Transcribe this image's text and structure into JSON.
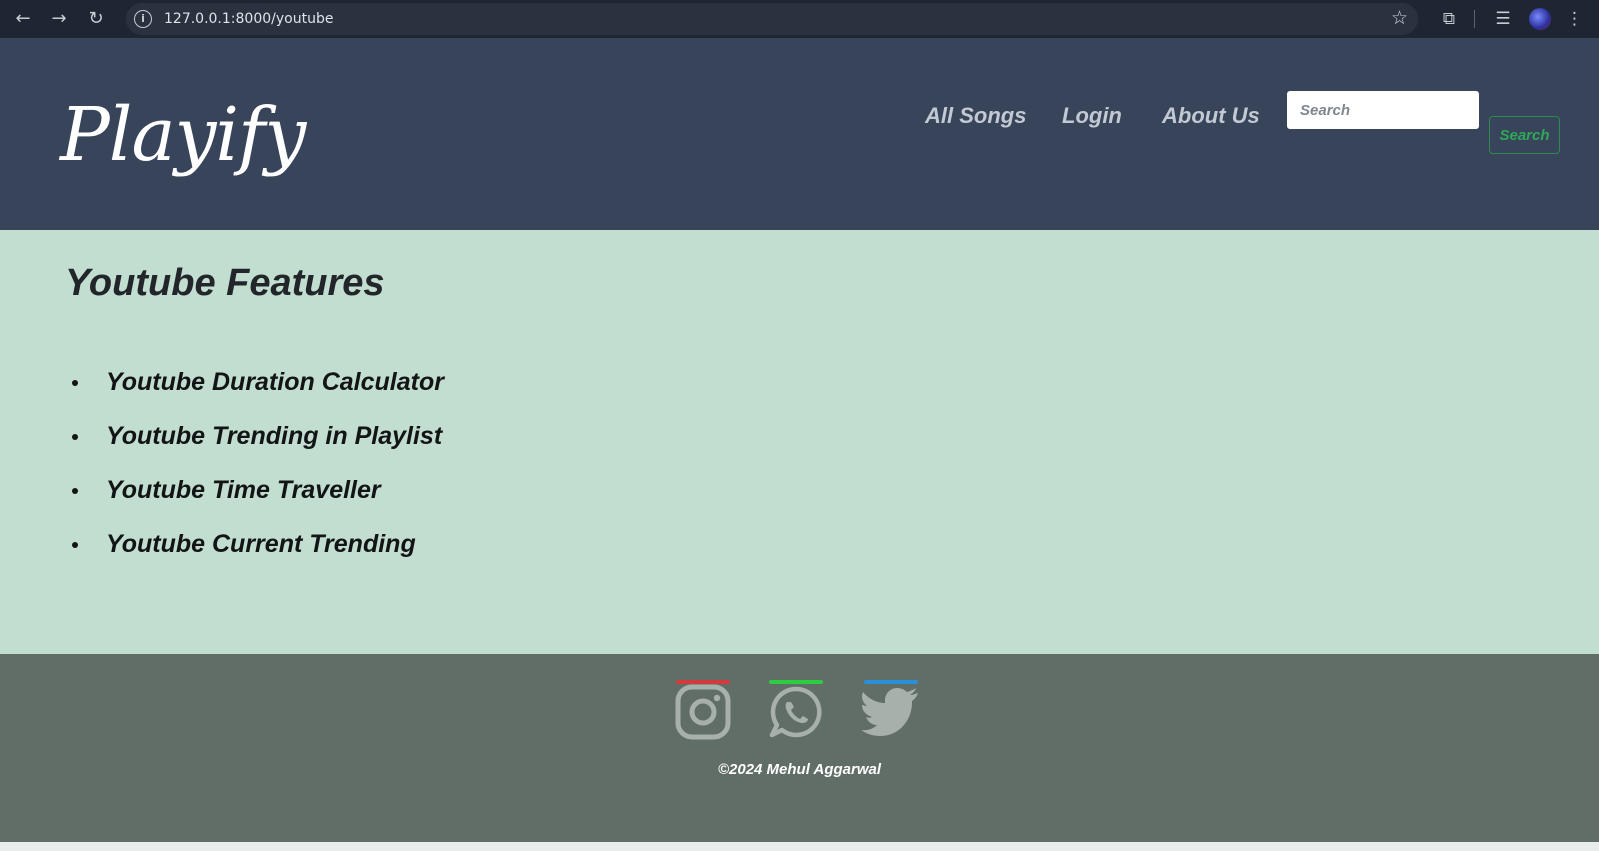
{
  "browser": {
    "url": "127.0.0.1:8000/youtube",
    "icons": [
      "back-icon",
      "forward-icon",
      "reload-icon",
      "info-icon",
      "bookmark-star-icon",
      "extensions-icon",
      "reading-list-icon",
      "profile-avatar",
      "menu-icon"
    ]
  },
  "header": {
    "logo": "Playify",
    "nav": [
      {
        "label": "All Songs"
      },
      {
        "label": "Login"
      },
      {
        "label": "About Us"
      }
    ],
    "search": {
      "placeholder": "Search",
      "button_label": "Search"
    }
  },
  "main": {
    "title": "Youtube Features",
    "features": [
      {
        "label": "Youtube Duration Calculator"
      },
      {
        "label": "Youtube Trending in Playlist"
      },
      {
        "label": "Youtube Time Traveller"
      },
      {
        "label": "Youtube Current Trending"
      }
    ]
  },
  "footer": {
    "social": [
      {
        "icon": "instagram-icon",
        "accent": "#d43a3a"
      },
      {
        "icon": "whatsapp-icon",
        "accent": "#2ecc40"
      },
      {
        "icon": "twitter-icon",
        "accent": "#2a8fd6"
      }
    ],
    "copyright": "©2024 Mehul Aggarwal"
  },
  "colors": {
    "header_bg": "#37445a",
    "main_bg": "#c2ded0",
    "footer_bg": "#606e67",
    "search_button": "#2fa85a"
  }
}
